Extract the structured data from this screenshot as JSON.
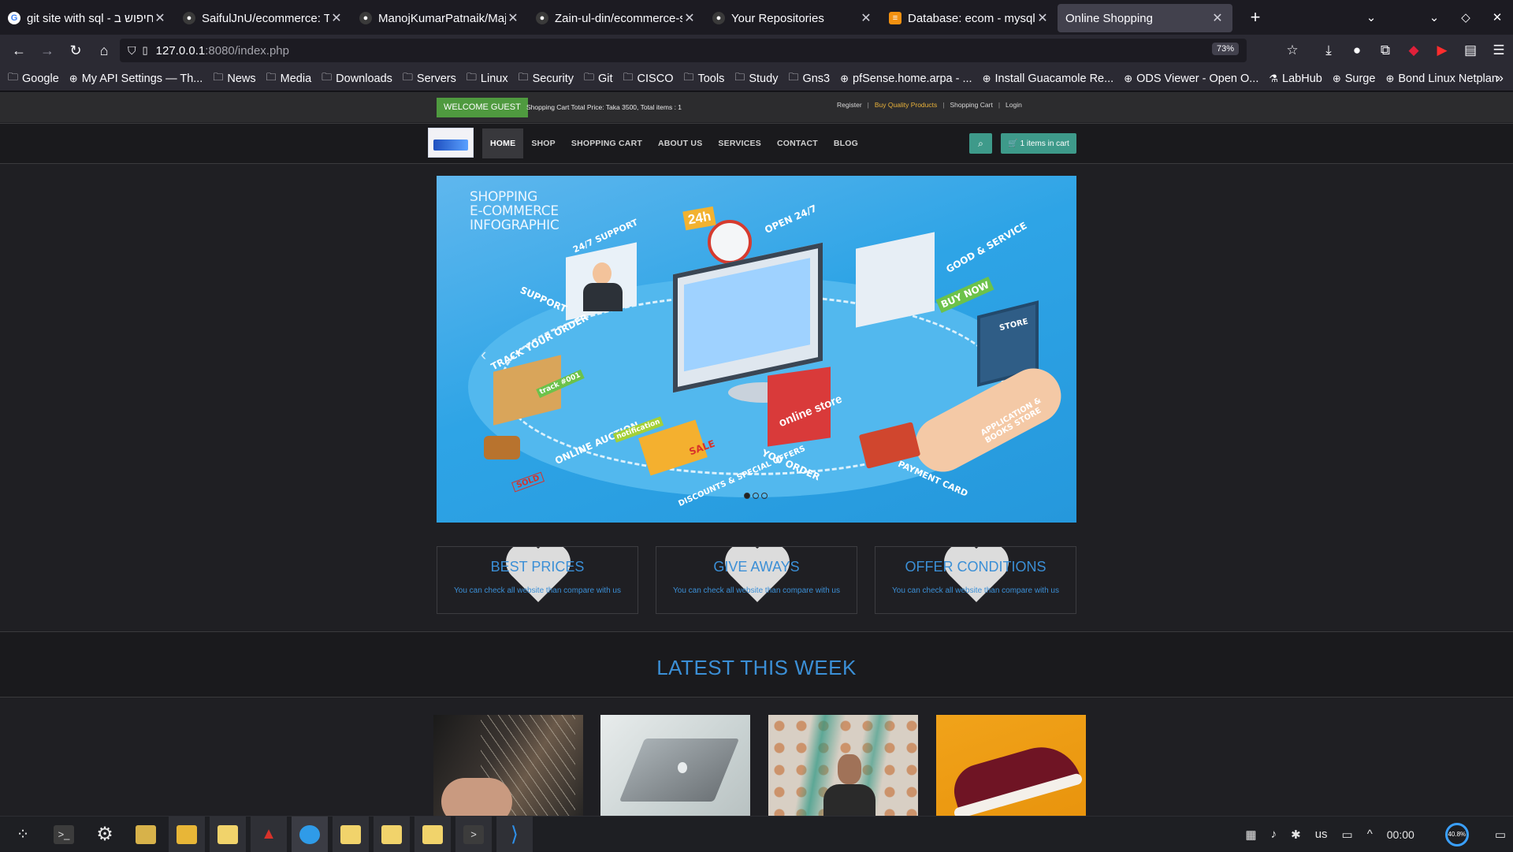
{
  "browser": {
    "tabs": [
      {
        "title": "git site with sql - חיפוש ב-Google",
        "icon": "google-icon"
      },
      {
        "title": "SaifulJnU/ecommerce: This",
        "icon": "github-icon"
      },
      {
        "title": "ManojKumarPatnaik/Major",
        "icon": "github-icon"
      },
      {
        "title": "Zain-ul-din/ecommerce-site",
        "icon": "github-icon"
      },
      {
        "title": "Your Repositories",
        "icon": "github-icon"
      },
      {
        "title": "Database: ecom - mysqlse",
        "icon": "database-icon"
      },
      {
        "title": "Online Shopping",
        "icon": "none"
      }
    ],
    "url_host": "127.0.0.1",
    "url_rest": ":8080/index.php",
    "zoom": "73%",
    "bookmarks": [
      {
        "label": "Google",
        "icon": "folder-icon"
      },
      {
        "label": "My API Settings — Th...",
        "icon": "globe-icon"
      },
      {
        "label": "News",
        "icon": "folder-icon"
      },
      {
        "label": "Media",
        "icon": "folder-icon"
      },
      {
        "label": "Downloads",
        "icon": "folder-icon"
      },
      {
        "label": "Servers",
        "icon": "folder-icon"
      },
      {
        "label": "Linux",
        "icon": "folder-icon"
      },
      {
        "label": "Security",
        "icon": "folder-icon"
      },
      {
        "label": "Git",
        "icon": "folder-icon"
      },
      {
        "label": "CISCO",
        "icon": "folder-icon"
      },
      {
        "label": "Tools",
        "icon": "folder-icon"
      },
      {
        "label": "Study",
        "icon": "folder-icon"
      },
      {
        "label": "Gns3",
        "icon": "folder-icon"
      },
      {
        "label": "pfSense.home.arpa - ...",
        "icon": "globe-icon"
      },
      {
        "label": "Install Guacamole Re...",
        "icon": "globe-icon"
      },
      {
        "label": "ODS Viewer - Open O...",
        "icon": "globe-icon"
      },
      {
        "label": "LabHub",
        "icon": "flask-icon"
      },
      {
        "label": "Surge",
        "icon": "globe-icon"
      },
      {
        "label": "Bond Linux Netplan",
        "icon": "globe-icon"
      }
    ]
  },
  "site": {
    "welcome": "WELCOME GUEST",
    "cart_total": "Shopping Cart Total Price: Taka 3500, Total items : 1",
    "top_links": [
      "Register",
      "Buy Quality Products",
      "Shopping Cart",
      "Login"
    ],
    "menu": [
      "HOME",
      "SHOP",
      "SHOPPING CART",
      "ABOUT US",
      "SERVICES",
      "CONTACT",
      "BLOG"
    ],
    "cart_button": "1 items in cart",
    "hero": {
      "title_lines": [
        "SHOPPING",
        "E-COMMERCE",
        "INFOGRAPHIC"
      ],
      "labels": [
        "24h",
        "OPEN 24/7",
        "24/7 SUPPORT",
        "SUPPORT",
        "TRACK YOUR ORDER",
        "GOOD & SERVICE",
        "BUY NOW",
        "STORE",
        "APPLICATION & BOOKS STORE",
        "online store",
        "YOU ORDER",
        "PAYMENT CARD",
        "ONLINE AUCTION",
        "notification",
        "SALE",
        "SOLD",
        "DISCOUNTS & SPECIAL OFFERS",
        "track #001"
      ],
      "slides": 3,
      "active_slide": 1
    },
    "features": [
      {
        "title": "BEST PRICES",
        "desc": "You can check all website than compare with us"
      },
      {
        "title": "GIVE AWAYS",
        "desc": "You can check all website than compare with us"
      },
      {
        "title": "OFFER CONDITIONS",
        "desc": "You can check all website than compare with us"
      }
    ],
    "latest_title": "LATEST THIS WEEK",
    "products": [
      {
        "image": "guitar"
      },
      {
        "image": "laptop"
      },
      {
        "image": "man-portrait"
      },
      {
        "image": "sneaker"
      }
    ]
  },
  "taskbar": {
    "apps": [
      "launcher-icon",
      "terminal-icon",
      "settings-icon",
      "notes-icon",
      "files-icon",
      "text-editor-icon",
      "lighthouse-icon",
      "browser-icon",
      "text-editor-icon",
      "text-editor-icon",
      "text-editor-icon",
      "terminal-icon",
      "vscode-icon"
    ],
    "keyboard_layout": "us",
    "clock": "00:00",
    "cpu": "40.8%"
  }
}
